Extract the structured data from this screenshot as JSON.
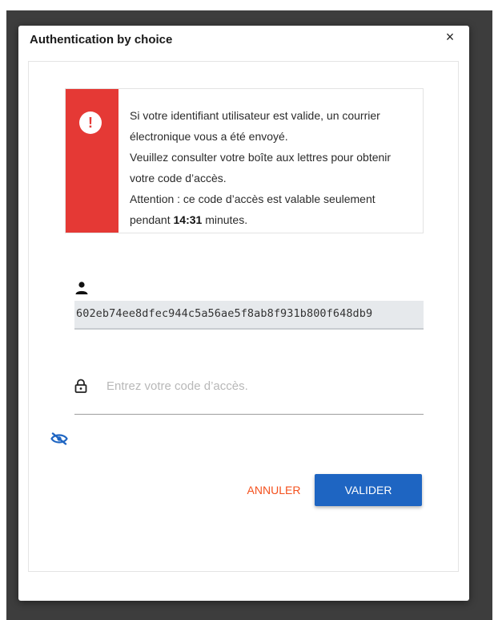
{
  "dialog": {
    "title": "Authentication by choice",
    "close_label": "×"
  },
  "alert": {
    "icon_symbol": "!",
    "line1": "Si votre identifiant utilisateur est valide, un courrier électronique vous a été envoyé.",
    "line2": "Veuillez consulter votre boîte aux lettres pour obtenir votre code d’accès.",
    "line3_prefix": "Attention : ce code d’accès est valable seulement pendant ",
    "countdown": "14:31",
    "line3_suffix": " minutes.",
    "stripe_color": "#e53935"
  },
  "user": {
    "icon": "person-icon",
    "value": "602eb74ee8dfec944c5a56ae5f8ab8f931b800f648db9"
  },
  "password": {
    "icon": "lock-icon",
    "placeholder": "Entrez votre code d’accès.",
    "value": "",
    "toggle_icon": "eye-slash-icon"
  },
  "actions": {
    "cancel_label": "ANNULER",
    "validate_label": "VALIDER",
    "cancel_color": "#f4511e",
    "validate_color": "#1e65c2"
  }
}
